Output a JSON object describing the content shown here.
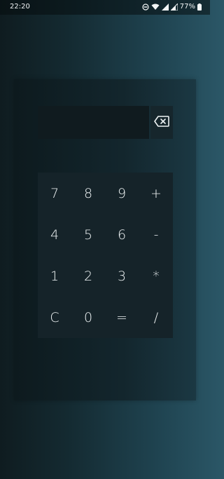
{
  "status_bar": {
    "time": "22:20",
    "battery": "77%",
    "icons": [
      "dnd-icon",
      "wifi-icon",
      "signal-icon-1",
      "signal-icon-2",
      "battery-icon"
    ]
  },
  "display": {
    "value": ""
  },
  "keypad": {
    "rows": [
      [
        "7",
        "8",
        "9",
        "+"
      ],
      [
        "4",
        "5",
        "6",
        "-"
      ],
      [
        "1",
        "2",
        "3",
        "*"
      ],
      [
        "C",
        "0",
        "=",
        "/"
      ]
    ]
  },
  "colors": {
    "background_start": "#0f1c20",
    "background_end": "#2b5767",
    "keypad_bg": "#152329",
    "text": "#eef3f4"
  }
}
